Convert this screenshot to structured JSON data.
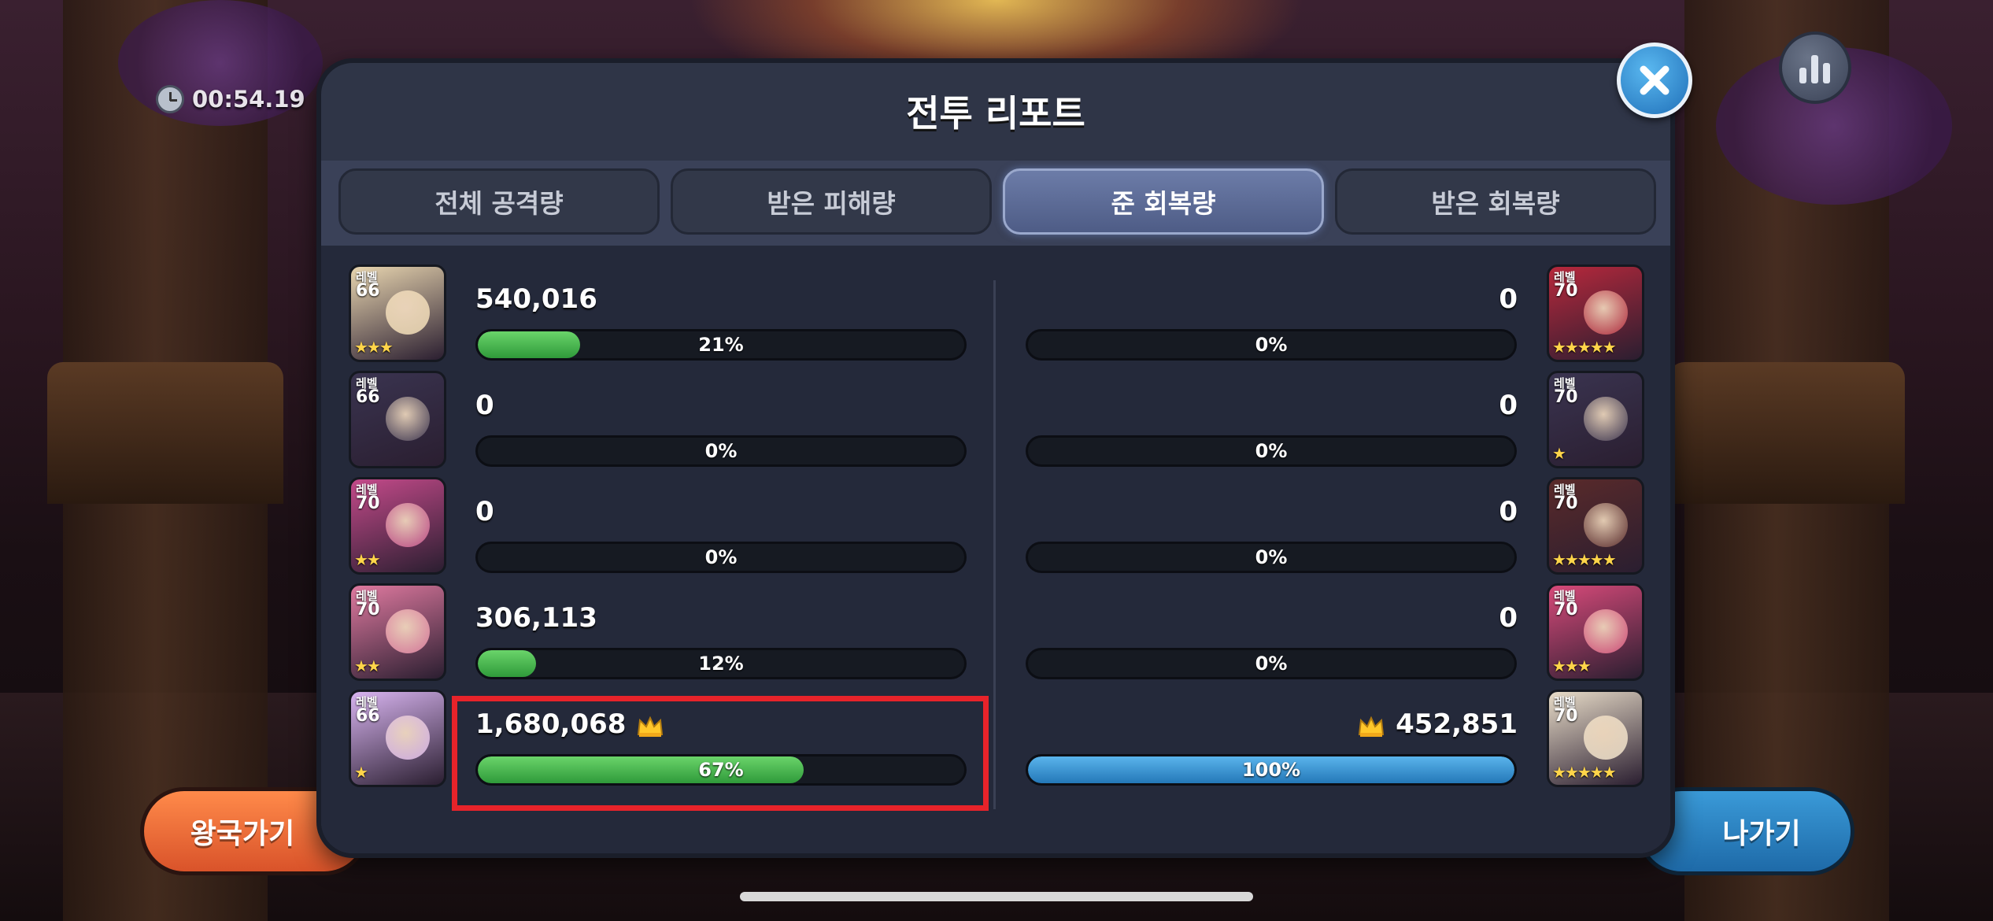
{
  "timer": {
    "value": "00:54.19",
    "icon": "clock-icon"
  },
  "panel": {
    "title": "전투 리포트"
  },
  "tabs": [
    {
      "label": "전체 공격량",
      "active": false
    },
    {
      "label": "받은 피해량",
      "active": false
    },
    {
      "label": "준 회복량",
      "active": true
    },
    {
      "label": "받은 회복량",
      "active": false
    }
  ],
  "left_team": [
    {
      "level_label": "레벨",
      "level": "66",
      "stars": "★★★",
      "amount": "540,016",
      "percent": "21%",
      "fraction": 0.21,
      "crown": false,
      "color": "#e9d6b0"
    },
    {
      "level_label": "레벨",
      "level": "66",
      "stars": "",
      "amount": "0",
      "percent": "0%",
      "fraction": 0,
      "crown": false,
      "color": "#3a3450"
    },
    {
      "level_label": "레벨",
      "level": "70",
      "stars": "★★",
      "amount": "0",
      "percent": "0%",
      "fraction": 0,
      "crown": false,
      "color": "#c44a8a"
    },
    {
      "level_label": "레벨",
      "level": "70",
      "stars": "★★",
      "amount": "306,113",
      "percent": "12%",
      "fraction": 0.12,
      "crown": false,
      "color": "#e07aa0"
    },
    {
      "level_label": "레벨",
      "level": "66",
      "stars": "★",
      "amount": "1,680,068",
      "percent": "67%",
      "fraction": 0.67,
      "crown": true,
      "color": "#d8b4f0"
    }
  ],
  "right_team": [
    {
      "level_label": "레벨",
      "level": "70",
      "stars": "★★★★★",
      "amount": "0",
      "percent": "0%",
      "fraction": 0,
      "crown": false,
      "color": "#b8283c"
    },
    {
      "level_label": "레벨",
      "level": "70",
      "stars": "★",
      "amount": "0",
      "percent": "0%",
      "fraction": 0,
      "crown": false,
      "color": "#3a3450"
    },
    {
      "level_label": "레벨",
      "level": "70",
      "stars": "★★★★★",
      "amount": "0",
      "percent": "0%",
      "fraction": 0,
      "crown": false,
      "color": "#5a2a2a"
    },
    {
      "level_label": "레벨",
      "level": "70",
      "stars": "★★★",
      "amount": "0",
      "percent": "0%",
      "fraction": 0,
      "crown": false,
      "color": "#d84a7a"
    },
    {
      "level_label": "레벨",
      "level": "70",
      "stars": "★★★★★",
      "amount": "452,851",
      "percent": "100%",
      "fraction": 1.0,
      "crown": true,
      "color": "#e8dcc8"
    }
  ],
  "buttons": {
    "kingdom": "왕국가기",
    "exit": "나가기"
  },
  "colors": {
    "left_bar": "#3fb04a",
    "right_bar": "#3a96d8",
    "highlight": "#e8232a",
    "panel": "#2f3547"
  }
}
